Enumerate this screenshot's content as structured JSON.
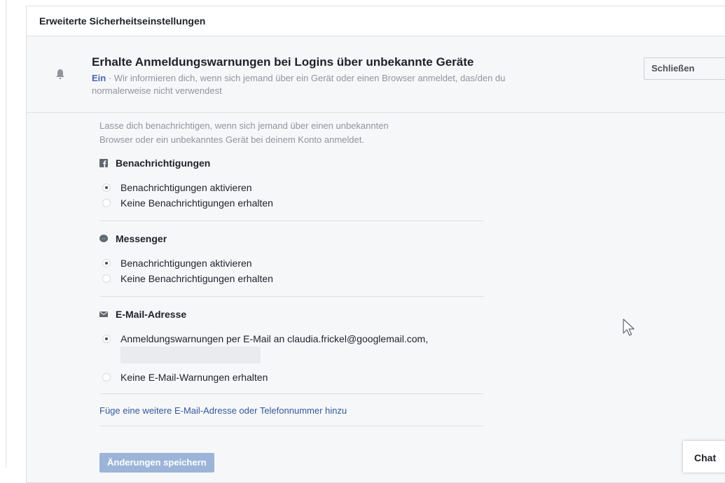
{
  "panel": {
    "header": "Erweiterte Sicherheitseinstellungen"
  },
  "setting": {
    "title": "Erhalte Anmeldungswarnungen bei Logins über unbekannte Geräte",
    "status": "Ein",
    "separator": " · ",
    "description_line1": "Wir informieren dich, wenn sich jemand über ein Gerät oder einen Browser anmeldet, das/den du",
    "description_line2": "normalerweise nicht verwendest",
    "close_label": "Schließen"
  },
  "content": {
    "intro_line1": "Lasse dich benachrichtigen, wenn sich jemand über einen unbekannten",
    "intro_line2": "Browser oder ein unbekanntes Gerät bei deinem Konto anmeldet.",
    "sections": [
      {
        "title": "Benachrichtigungen",
        "icon": "facebook-icon",
        "options": [
          {
            "label": "Benachrichtigungen aktivieren",
            "checked": true
          },
          {
            "label": "Keine Benachrichtigungen erhalten",
            "checked": false
          }
        ]
      },
      {
        "title": "Messenger",
        "icon": "messenger-icon",
        "options": [
          {
            "label": "Benachrichtigungen aktivieren",
            "checked": true
          },
          {
            "label": "Keine Benachrichtigungen erhalten",
            "checked": false
          }
        ]
      },
      {
        "title": "E-Mail-Adresse",
        "icon": "envelope-icon",
        "options": [
          {
            "label": "Anmeldungswarnungen per E-Mail an claudia.frickel@googlemail.com,",
            "checked": true
          },
          {
            "label": "Keine E-Mail-Warnungen erhalten",
            "checked": false
          }
        ]
      }
    ],
    "add_link": "Füge eine weitere E-Mail-Adresse oder Telefonnummer hinzu",
    "save_label": "Änderungen speichern"
  },
  "chat": {
    "label": "Chat"
  },
  "colors": {
    "link": "#365899",
    "status_on": "#4267b2",
    "panel_bg": "#f6f7f9",
    "border": "#dddfe2"
  }
}
